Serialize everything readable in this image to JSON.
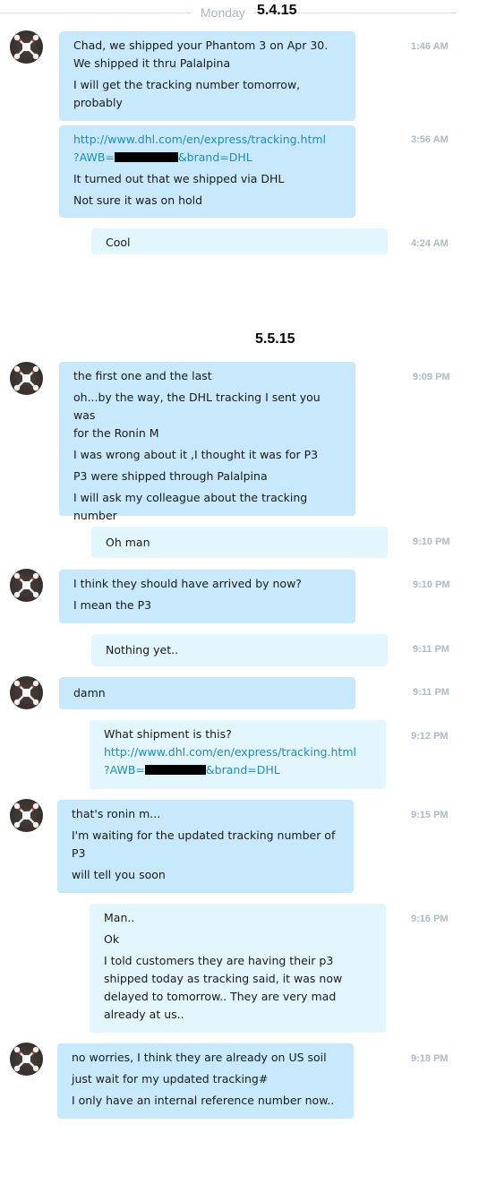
{
  "day_label": "Monday",
  "dates": {
    "first": "5.4.15",
    "second": "5.5.15"
  },
  "messages": [
    {
      "lines": [
        "Chad,  we shipped your Phantom 3 on Apr 30.",
        "We shipped it thru Palalpina"
      ],
      "lines2": [
        "I will get the tracking number tomorrow,",
        "probably"
      ],
      "time": "1:46 AM"
    },
    {
      "link1": "http://www.dhl.com/en/express/tracking.html",
      "link2a": "?AWB=",
      "link2b": "&brand=DHL",
      "lines": [
        "It turned out that we shipped via DHL",
        "Not sure it was on hold"
      ],
      "time": "3:56 AM"
    },
    {
      "lines": [
        "Cool"
      ],
      "time": "4:24 AM"
    },
    {
      "lines": [
        "the first one and the last",
        "oh...by the way, the DHL tracking I sent you was",
        "for the Ronin M",
        "I was wrong about it ,I thought it was for P3",
        "P3 were shipped through Palalpina",
        "I will ask my colleague about the tracking",
        "number"
      ],
      "time": "9:09 PM"
    },
    {
      "lines": [
        "Oh man"
      ],
      "time": "9:10 PM"
    },
    {
      "lines": [
        "I think they should have arrived by now?",
        "I mean the P3"
      ],
      "time": "9:10 PM"
    },
    {
      "lines": [
        "Nothing yet.."
      ],
      "time": "9:11 PM"
    },
    {
      "lines": [
        "damn"
      ],
      "time": "9:11 PM"
    },
    {
      "line0": "What shipment is this?",
      "link1": "http://www.dhl.com/en/express/tracking.html",
      "link2a": "?AWB=",
      "link2b": "&brand=DHL",
      "time": "9:12 PM"
    },
    {
      "lines": [
        "that's ronin m...",
        "I'm waiting for the updated tracking number of",
        "P3",
        "will tell you soon"
      ],
      "time": "9:15 PM"
    },
    {
      "lines": [
        "Man..",
        "Ok",
        "I told customers they are having their p3",
        "shipped today as tracking said, it was now",
        "delayed to tomorrow.. They are very mad",
        "already at us.."
      ],
      "time": "9:16 PM"
    },
    {
      "lines": [
        "no worries, I think they are already on US soil",
        "just wait for my updated tracking#",
        "I only have an internal reference number now.."
      ],
      "time": "9:18 PM"
    }
  ],
  "colors": {
    "incoming": "#c7e9fb",
    "outgoing": "#e3f5fd",
    "link": "#1f8bc1",
    "timestamp": "#a9bcc9"
  },
  "icons": {
    "avatar": "drone-avatar-icon"
  }
}
